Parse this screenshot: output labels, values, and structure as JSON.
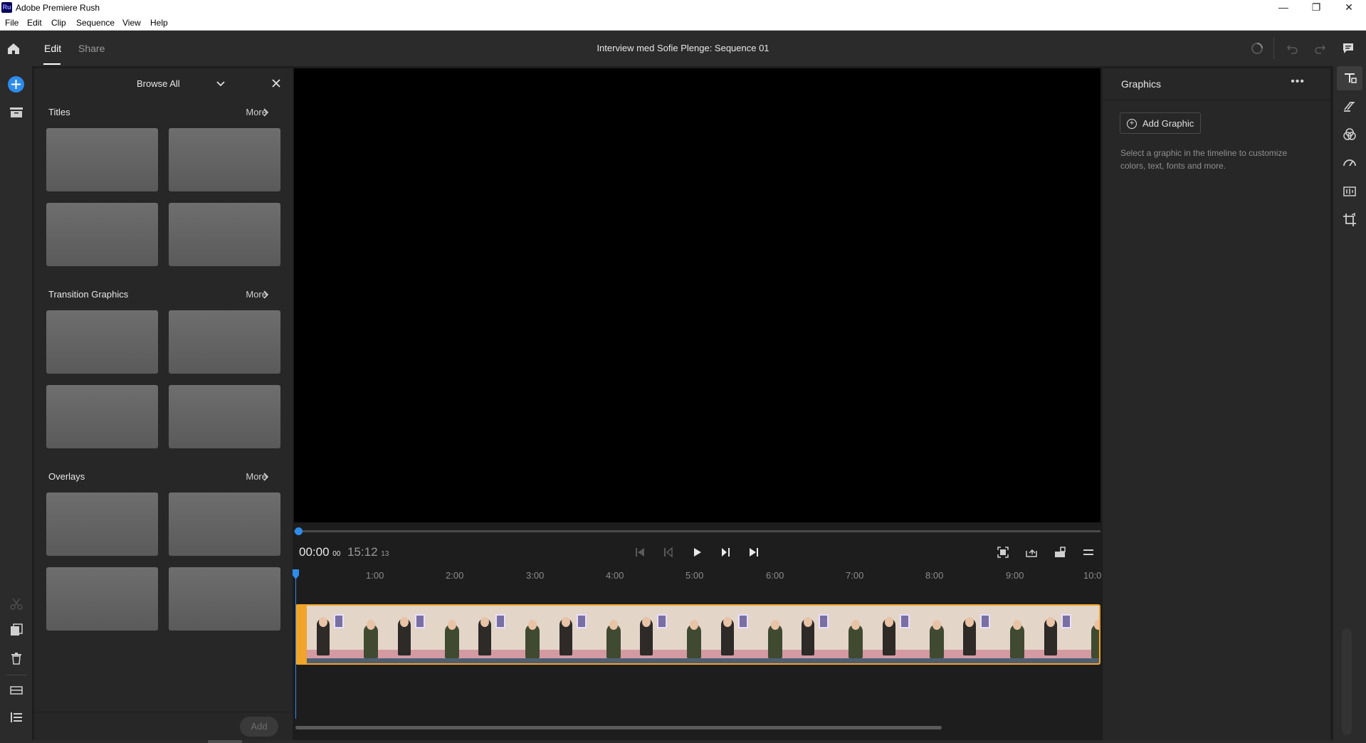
{
  "app": {
    "icon_text": "Ru",
    "title": "Adobe Premiere Rush"
  },
  "window_controls": {
    "minimize": "—",
    "restore": "❐",
    "close": "✕"
  },
  "menu": [
    "File",
    "Edit",
    "Clip",
    "Sequence",
    "View",
    "Help"
  ],
  "header": {
    "tabs": [
      {
        "label": "Edit",
        "active": true
      },
      {
        "label": "Share",
        "active": false
      }
    ],
    "sequence_title": "Interview med Sofie Plenge: Sequence 01",
    "icons": [
      "home-icon",
      "sync-spinner-icon",
      "undo-icon",
      "redo-icon",
      "comment-icon"
    ]
  },
  "browse": {
    "dropdown_label": "Browse All",
    "sections": [
      {
        "title": "Titles",
        "more": "More"
      },
      {
        "title": "Transition Graphics",
        "more": "More"
      },
      {
        "title": "Overlays",
        "more": "More"
      }
    ],
    "add_label": "Add"
  },
  "viewer": {
    "timecode_current": "00:00",
    "timecode_current_frames": "00",
    "timecode_total": "15:12",
    "timecode_total_frames": "13"
  },
  "timeline": {
    "ticks": [
      "1:00",
      "2:00",
      "3:00",
      "4:00",
      "5:00",
      "6:00",
      "7:00",
      "8:00",
      "9:00",
      "10:0"
    ]
  },
  "properties": {
    "title": "Graphics",
    "more": "•••",
    "add_graphic_label": "Add Graphic",
    "hint": "Select a graphic in the timeline to customize colors, text, fonts and more."
  },
  "colors": {
    "accent": "#2d8ceb",
    "clip_border": "#f0a42a"
  }
}
